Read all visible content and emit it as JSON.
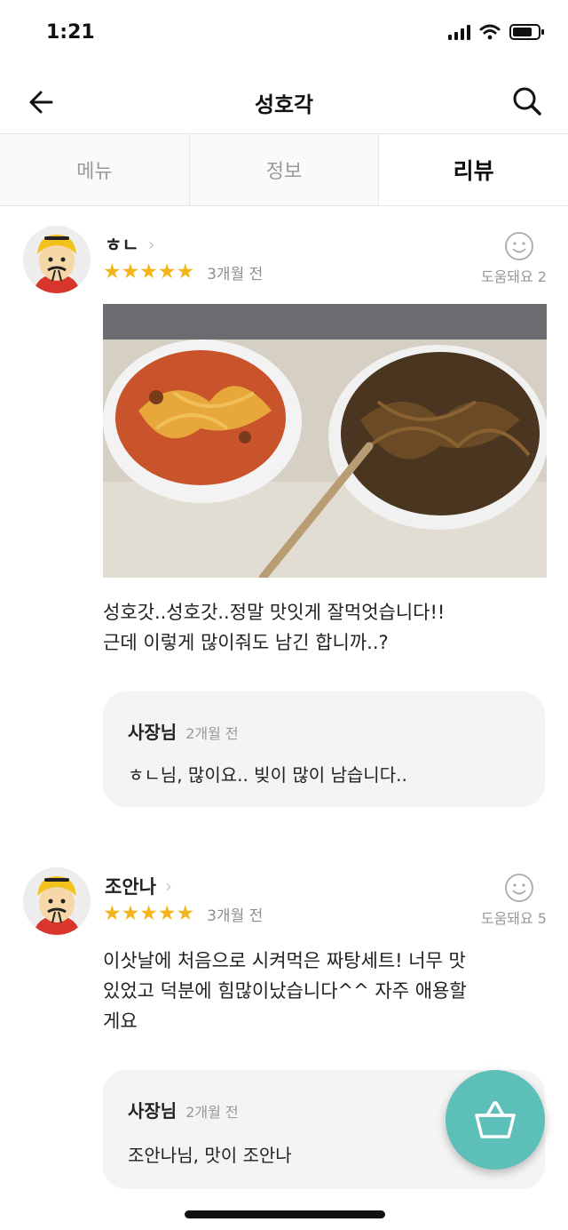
{
  "status_bar": {
    "time": "1:21"
  },
  "nav": {
    "title": "성호각",
    "back_icon": "arrow-left-icon",
    "search_icon": "search-icon"
  },
  "tabs": [
    {
      "label": "메뉴",
      "active": false
    },
    {
      "label": "정보",
      "active": false
    },
    {
      "label": "리뷰",
      "active": true
    }
  ],
  "reviews": [
    {
      "name": "ㅎㄴ",
      "rating": 5,
      "stars": "★★★★★",
      "date": "3개월 전",
      "helpful": "도움돼요 2",
      "has_photo": true,
      "text_lines": [
        "성호갓..성호갓..정말 맛잇게 잘먹엇습니다!!",
        "근데 이렇게 많이줘도 남긴 합니까..?"
      ],
      "reply": {
        "owner": "사장님",
        "date": "2개월 전",
        "text": "ㅎㄴ님, 많이요.. 빚이 많이 남습니다.."
      }
    },
    {
      "name": "조안나",
      "rating": 5,
      "stars": "★★★★★",
      "date": "3개월 전",
      "helpful": "도움돼요 5",
      "has_photo": false,
      "text_lines": [
        "이삿날에 처음으로 시켜먹은 짜탕세트! 너무 맛",
        "있었고 덕분에 힘많이났습니다^^ 자주 애용할",
        "게요"
      ],
      "reply": {
        "owner": "사장님",
        "date": "2개월 전",
        "text": "조안나님, 맛이 조안나"
      }
    }
  ],
  "colors": {
    "star": "#f3b51a",
    "fab": "#5cbfb8",
    "reply_bg": "#f4f4f4"
  },
  "fab_icon": "shopping-basket-icon"
}
